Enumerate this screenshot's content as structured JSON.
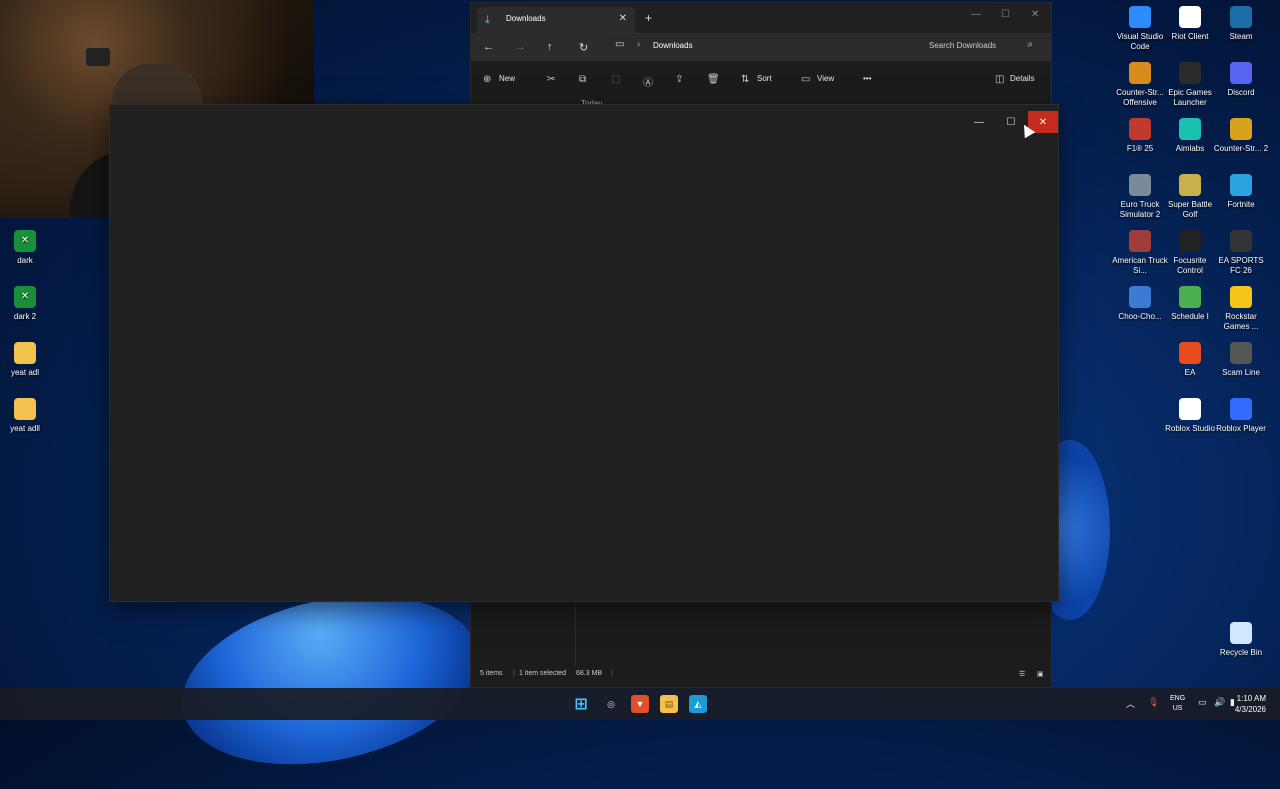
{
  "desktop": {
    "left_icons": [
      {
        "label": "dark",
        "icon": "game-icon"
      },
      {
        "label": "dark 2",
        "icon": "game-icon"
      },
      {
        "label": "yeat adl",
        "icon": "folder-icon"
      },
      {
        "label": "yeat adll",
        "icon": "folder-icon"
      }
    ],
    "right_icons": [
      {
        "label": "Visual Studio Code",
        "icon": "vscode-icon",
        "color": "#2e8bff"
      },
      {
        "label": "Riot Client",
        "icon": "doc-icon",
        "color": "#ffffff"
      },
      {
        "label": "Steam",
        "icon": "steam-icon",
        "color": "#1b6ea8"
      },
      {
        "label": "Counter-Str... Offensive",
        "icon": "game-icon",
        "color": "#d98b1d"
      },
      {
        "label": "Epic Games Launcher",
        "icon": "epic-icon",
        "color": "#2b2b2b"
      },
      {
        "label": "Discord",
        "icon": "discord-icon",
        "color": "#5865f2"
      },
      {
        "label": "F1® 25",
        "icon": "game-icon",
        "color": "#c0392b"
      },
      {
        "label": "Aimlabs",
        "icon": "aimlabs-icon",
        "color": "#19c2b0"
      },
      {
        "label": "Counter-Str... 2",
        "icon": "game-icon",
        "color": "#d9a21d"
      },
      {
        "label": "Euro Truck Simulator 2",
        "icon": "game-icon",
        "color": "#7a8a99"
      },
      {
        "label": "Super Battle Golf",
        "icon": "game-icon",
        "color": "#c8b04a"
      },
      {
        "label": "Fortnite",
        "icon": "game-icon",
        "color": "#2aa4e0"
      },
      {
        "label": "American Truck Si...",
        "icon": "game-icon",
        "color": "#a03c3c"
      },
      {
        "label": "Focusrite Control",
        "icon": "focusrite-icon",
        "color": "#222222"
      },
      {
        "label": "EA SPORTS FC 26",
        "icon": "game-icon",
        "color": "#333333"
      },
      {
        "label": "Choo-Cho...",
        "icon": "game-icon",
        "color": "#3a7bd5"
      },
      {
        "label": "Schedule I",
        "icon": "game-icon",
        "color": "#4caf50"
      },
      {
        "label": "Rockstar Games ...",
        "icon": "rockstar-icon",
        "color": "#f5c518"
      },
      {
        "label": "EA",
        "icon": "ea-icon",
        "color": "#e84c1e"
      },
      {
        "label": "Scam Line",
        "icon": "game-icon",
        "color": "#555555"
      },
      {
        "label": "Roblox Studio",
        "icon": "doc-icon",
        "color": "#ffffff"
      },
      {
        "label": "Roblox Player",
        "icon": "roblox-icon",
        "color": "#2f6bff"
      },
      {
        "label": "Recycle Bin",
        "icon": "recycle-bin-icon",
        "color": "#cfe8ff"
      }
    ]
  },
  "explorer": {
    "tab_title": "Downloads",
    "address_path": "Downloads",
    "search_placeholder": "Search Downloads",
    "toolbar": {
      "new_label": "New",
      "sort_label": "Sort",
      "view_label": "View",
      "more_label": "•••",
      "details_label": "Details"
    },
    "group_header": "Today",
    "status": {
      "items": "5 items",
      "selected": "1 item selected",
      "size": "68.3 MB"
    }
  },
  "taskbar": {
    "lang_line1": "ENG",
    "lang_line2": "US",
    "time": "1:10 AM",
    "date": "4/3/2026"
  }
}
